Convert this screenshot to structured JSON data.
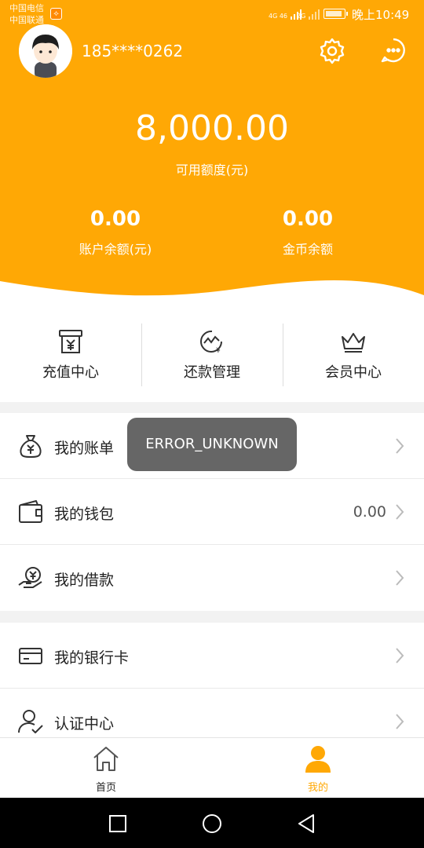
{
  "status_bar": {
    "carrier_1": "中国电信",
    "carrier_2": "中国联通",
    "signal_1": "4G 46",
    "signal_2": "2G",
    "time": "晚上10:49"
  },
  "profile": {
    "phone": "185****0262"
  },
  "credit": {
    "amount": "8,000.00",
    "label": "可用额度(元)"
  },
  "stats": [
    {
      "value": "0.00",
      "label": "账户余额(元)"
    },
    {
      "value": "0.00",
      "label": "金币余额"
    }
  ],
  "quick_actions": [
    {
      "label": "充值中心",
      "icon": "recharge-icon"
    },
    {
      "label": "还款管理",
      "icon": "repayment-icon"
    },
    {
      "label": "会员中心",
      "icon": "crown-icon"
    }
  ],
  "menu_group_1": [
    {
      "label": "我的账单",
      "icon": "money-bag-icon",
      "value": ""
    },
    {
      "label": "我的钱包",
      "icon": "wallet-icon",
      "value": "0.00"
    },
    {
      "label": "我的借款",
      "icon": "loan-icon",
      "value": ""
    }
  ],
  "menu_group_2": [
    {
      "label": "我的银行卡",
      "icon": "bank-card-icon",
      "value": ""
    },
    {
      "label": "认证中心",
      "icon": "user-verify-icon",
      "value": ""
    }
  ],
  "toast": "ERROR_UNKNOWN",
  "bottom_nav": [
    {
      "label": "首页",
      "icon": "home-icon"
    },
    {
      "label": "我的",
      "icon": "user-icon"
    }
  ],
  "colors": {
    "brand": "#ffa805"
  }
}
